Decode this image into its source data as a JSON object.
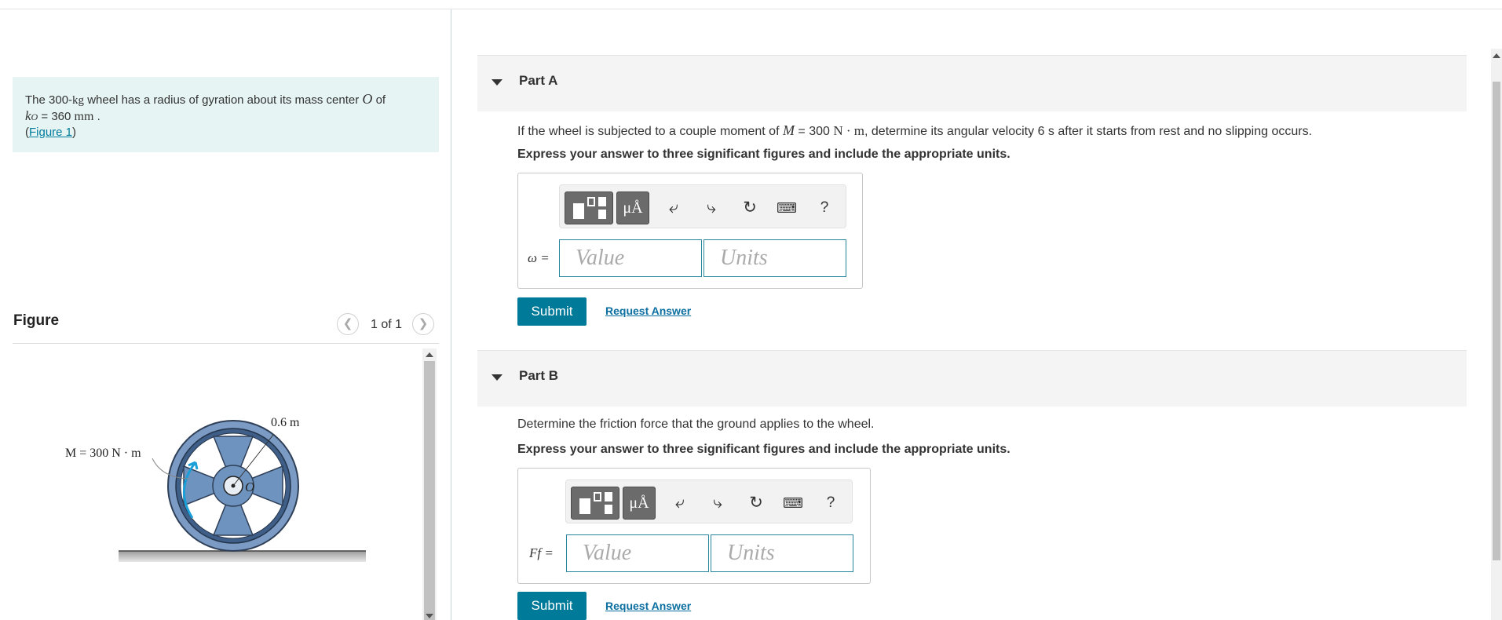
{
  "problem": {
    "t1": "The 300-",
    "mass_unit": "kg",
    "t2": " wheel has a radius of gyration about its mass center ",
    "point": "O",
    "t3": " of",
    "k_symbol": "k",
    "k_sub": "O",
    "k_eq": " = 360 ",
    "k_unit": "mm",
    "k_period": " .",
    "fig_open": "(",
    "fig_link": "Figure 1",
    "fig_close": ")"
  },
  "figure": {
    "title": "Figure",
    "pager": "1 of 1",
    "prev_icon": "chevron-left-icon",
    "next_icon": "chevron-right-icon",
    "moment_label": "M = 300 N · m",
    "radius_label": "0.6 m",
    "center_label": "O"
  },
  "parts": [
    {
      "label": "Part A",
      "q1": "If the wheel is subjected to a couple moment of ",
      "q_var": "M",
      "q2": " = 300 ",
      "q_unit": "N · m",
      "q3": ", determine its angular velocity 6 s after it starts from rest and no slipping occurs.",
      "instruction": "Express your answer to three significant figures and include the appropriate units.",
      "var_label": "ω =",
      "value_placeholder": "Value",
      "units_placeholder": "Units",
      "submit": "Submit",
      "request": "Request Answer"
    },
    {
      "label": "Part B",
      "question": "Determine the friction force that the ground applies to the wheel.",
      "instruction": "Express your answer to three significant figures and include the appropriate units.",
      "var_label": "Ff =",
      "value_placeholder": "Value",
      "units_placeholder": "Units",
      "submit": "Submit",
      "request": "Request Answer"
    }
  ],
  "toolbar": {
    "mu_label": "μÅ",
    "help_label": "?",
    "icons": [
      "templates-icon",
      "units-icon",
      "undo-icon",
      "redo-icon",
      "reset-icon",
      "keyboard-icon",
      "help-icon"
    ]
  },
  "colors": {
    "accent": "#007a99",
    "problem_bg": "#e6f4f4",
    "wheel": "#6f93bf"
  }
}
